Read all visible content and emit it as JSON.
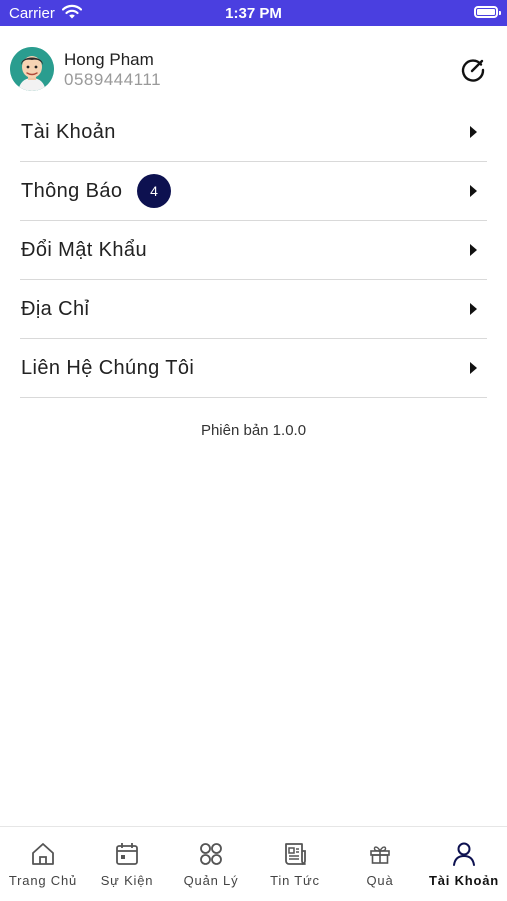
{
  "status_bar": {
    "carrier": "Carrier",
    "time": "1:37 PM"
  },
  "profile": {
    "name": "Hong Pham",
    "phone": "0589444111"
  },
  "menu": [
    {
      "label": "Tài Khoản"
    },
    {
      "label": "Thông Báo",
      "badge": "4"
    },
    {
      "label": "Đổi Mật Khẩu"
    },
    {
      "label": "Địa Chỉ"
    },
    {
      "label": "Liên Hệ Chúng Tôi"
    }
  ],
  "version": "Phiên bản 1.0.0",
  "tabs": [
    {
      "label": "Trang Chủ",
      "icon": "home-icon"
    },
    {
      "label": "Sự Kiện",
      "icon": "calendar-icon"
    },
    {
      "label": "Quản Lý",
      "icon": "grid-circles-icon"
    },
    {
      "label": "Tin Tức",
      "icon": "news-icon"
    },
    {
      "label": "Quà",
      "icon": "gift-icon"
    },
    {
      "label": "Tài Khoản",
      "icon": "user-icon",
      "active": true
    }
  ],
  "colors": {
    "status_bar": "#4a3fe0",
    "badge": "#0d1150",
    "active_tab": "#0d1150",
    "inactive_tab": "#555555"
  }
}
